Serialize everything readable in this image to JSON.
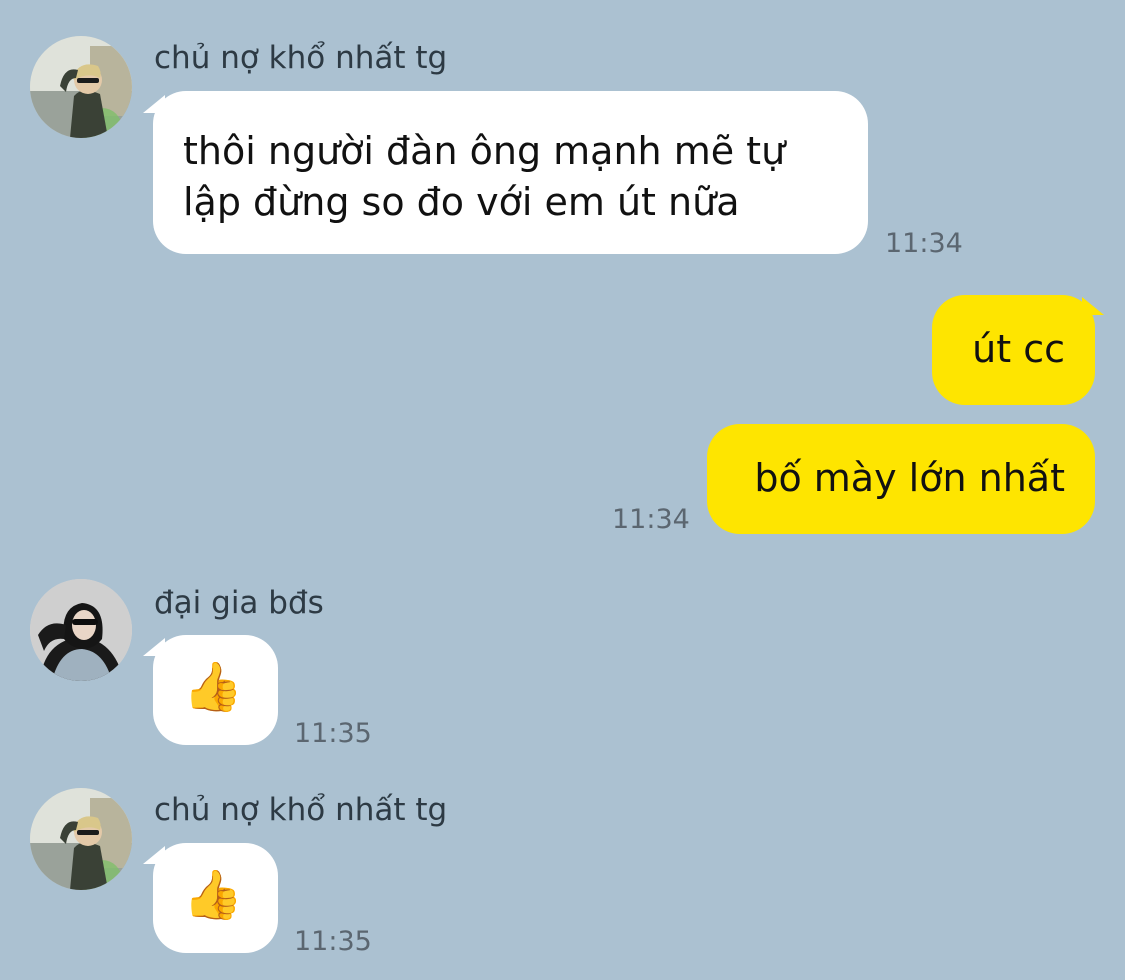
{
  "conversation": {
    "messages": [
      {
        "sender": "chủ nợ khổ nhất tg",
        "text_line1": "thôi người đàn ông mạnh mẽ tự",
        "text_line2": "lập đừng so đo với em út nữa",
        "time": "11:34"
      },
      {
        "text": "út cc"
      },
      {
        "text": "bố mày lớn nhất",
        "time": "11:34"
      },
      {
        "sender": "đại gia bđs",
        "emoji": "👍",
        "time": "11:35"
      },
      {
        "sender": "chủ nợ khổ nhất tg",
        "emoji": "👍",
        "time": "11:35"
      }
    ]
  },
  "colors": {
    "background": "#abc1d1",
    "incoming_bubble": "#ffffff",
    "outgoing_bubble": "#fee500",
    "timestamp": "#5b6670"
  },
  "icons": {
    "reaction": "thumbs-up-emoji"
  }
}
